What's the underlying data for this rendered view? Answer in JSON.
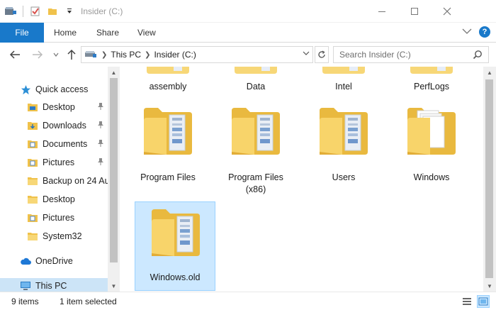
{
  "window": {
    "title": "Insider (C:)"
  },
  "ribbon": {
    "file_label": "File",
    "home_label": "Home",
    "share_label": "Share",
    "view_label": "View"
  },
  "breadcrumb": {
    "items": [
      "This PC",
      "Insider (C:)"
    ]
  },
  "search": {
    "placeholder": "Search Insider (C:)"
  },
  "nav": {
    "quick_access": "Quick access",
    "items": [
      {
        "label": "Desktop",
        "pinned": true
      },
      {
        "label": "Downloads",
        "pinned": true
      },
      {
        "label": "Documents",
        "pinned": true
      },
      {
        "label": "Pictures",
        "pinned": true
      },
      {
        "label": "Backup on 24 Au",
        "pinned": false
      },
      {
        "label": "Desktop",
        "pinned": false
      },
      {
        "label": "Pictures",
        "pinned": false
      },
      {
        "label": "System32",
        "pinned": false
      }
    ],
    "onedrive": "OneDrive",
    "thispc": "This PC"
  },
  "content": {
    "top_row": [
      "assembly",
      "Data",
      "Intel",
      "PerfLogs"
    ],
    "folders": [
      {
        "label": "Program Files",
        "label2": ""
      },
      {
        "label": "Program Files",
        "label2": "(x86)"
      },
      {
        "label": "Users",
        "label2": ""
      },
      {
        "label": "Windows",
        "label2": ""
      },
      {
        "label": "Windows.old",
        "label2": ""
      }
    ]
  },
  "status": {
    "item_count": "9 items",
    "selected": "1 item selected"
  },
  "colors": {
    "accent": "#1979ca",
    "selection": "#cce8ff",
    "folder": "#f7d777"
  }
}
